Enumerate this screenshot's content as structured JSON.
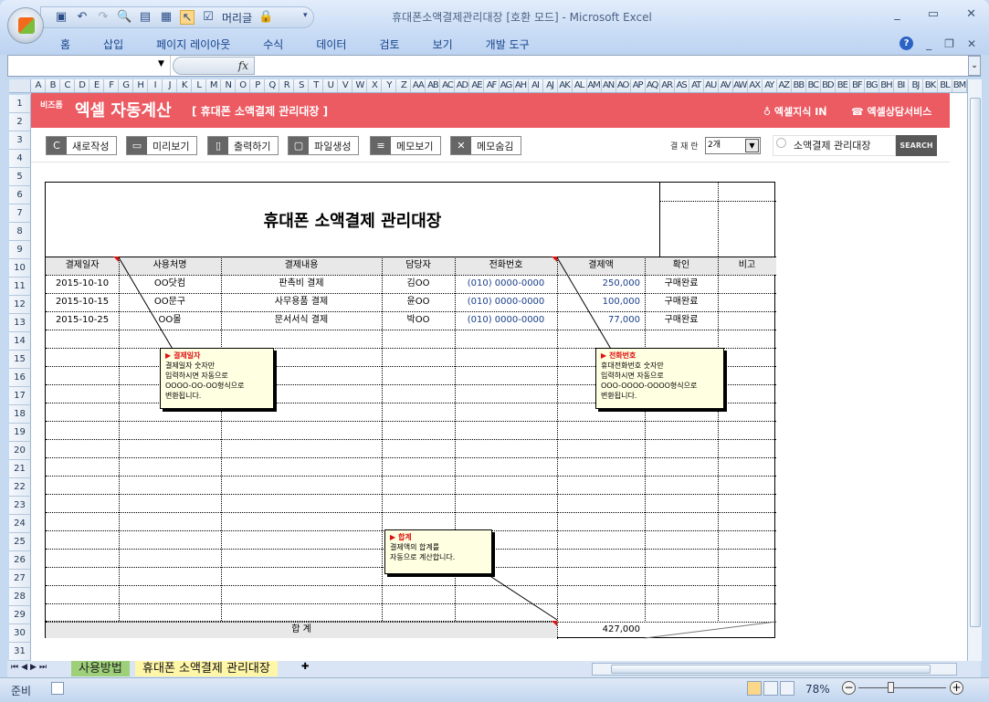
{
  "window": {
    "title": "휴대폰소액결제관리대장  [호환 모드] - Microsoft Excel",
    "qat_label": "머리글"
  },
  "ribbon": {
    "tabs": [
      "홈",
      "삽입",
      "페이지 레이아웃",
      "수식",
      "데이터",
      "검토",
      "보기",
      "개발 도구"
    ]
  },
  "columns": [
    "A",
    "B",
    "C",
    "D",
    "E",
    "F",
    "G",
    "H",
    "I",
    "J",
    "K",
    "L",
    "M",
    "N",
    "O",
    "P",
    "Q",
    "R",
    "S",
    "T",
    "U",
    "V",
    "W",
    "X",
    "Y",
    "Z",
    "AA",
    "AB",
    "AC",
    "AD",
    "AE",
    "AF",
    "AG",
    "AH",
    "AI",
    "AJ",
    "AK",
    "AL",
    "AM",
    "AN",
    "AO",
    "AP",
    "AQ",
    "AR",
    "AS",
    "AT",
    "AU",
    "AV",
    "AW",
    "AX",
    "AY",
    "AZ",
    "BB",
    "BC",
    "BD",
    "BE",
    "BF",
    "BG",
    "BH",
    "BI",
    "BJ",
    "BK",
    "BL",
    "BM"
  ],
  "banner": {
    "brand_small": "비즈폼",
    "brand": "엑셀 자동계산",
    "subtitle": "[ 휴대폰 소액결제 관리대장 ]",
    "link1": "엑셀지식 IN",
    "separator": "|",
    "link2": "엑셀상담서비스"
  },
  "toolbar": {
    "buttons": [
      "새로작성",
      "미리보기",
      "출력하기",
      "파일생성",
      "메모보기",
      "메모숨김"
    ],
    "pay_label": "결 재 란",
    "pay_value": "2개",
    "search_value": "소액결제 관리대장",
    "search_button": "SEARCH"
  },
  "doc": {
    "title": "휴대폰 소액결제 관리대장",
    "headers": [
      "결제일자",
      "사용처명",
      "결제내용",
      "담당자",
      "전화번호",
      "결제액",
      "확인",
      "비고"
    ],
    "rows": [
      [
        "2015-10-10",
        "OO닷컴",
        "판촉비 결제",
        "김OO",
        "(010) 0000-0000",
        "250,000",
        "구매완료",
        ""
      ],
      [
        "2015-10-15",
        "OO문구",
        "사무용품 결제",
        "윤OO",
        "(010) 0000-0000",
        "100,000",
        "구매완료",
        ""
      ],
      [
        "2015-10-25",
        "OO몰",
        "문서서식 결제",
        "박OO",
        "(010) 0000-0000",
        "77,000",
        "구매완료",
        ""
      ]
    ],
    "total_label": "합      계",
    "total_value": "427,000"
  },
  "notes": [
    {
      "title": "▶ 결제일자",
      "lines": [
        "결제일자 숫자만",
        "입력하시면 자동으로",
        "OOOO-OO-OO형식으로",
        "변환됩니다."
      ]
    },
    {
      "title": "▶ 전화번호",
      "lines": [
        "휴대전화번호 숫자만",
        "입력하시면 자동으로",
        "OOO-OOOO-OOOO형식으로",
        "변환됩니다."
      ]
    },
    {
      "title": "▶ 합계",
      "lines": [
        "결제액의 합계를",
        "자동으로 계산합니다."
      ]
    }
  ],
  "sheets": {
    "tabs": [
      "사용방법",
      "휴대폰 소액결제 관리대장"
    ],
    "active": 1
  },
  "status": {
    "ready": "준비",
    "zoom": "78%"
  }
}
